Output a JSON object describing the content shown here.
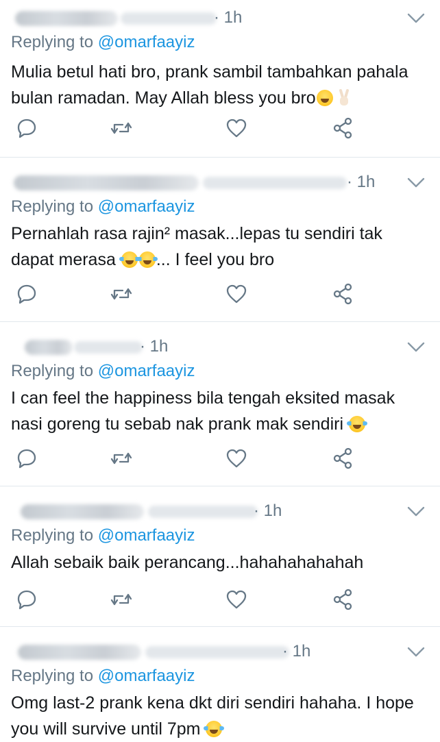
{
  "tweets": [
    {
      "time": "· 1h",
      "replying_label": "Replying to ",
      "mention": "@omarfaayiz",
      "text_lines": [
        "Mulia betul hati bro, prank sambil tambahkan pahala",
        "bulan ramadan. May Allah bless you bro"
      ]
    },
    {
      "time": "· 1h",
      "replying_label": "Replying to ",
      "mention": "@omarfaayiz",
      "text_lines": [
        "Pernahlah rasa rajin² masak...lepas tu sendiri tak",
        "dapat merasa",
        "... I feel you bro"
      ]
    },
    {
      "time": "· 1h",
      "replying_label": "Replying to ",
      "mention": "@omarfaayiz",
      "text_lines": [
        "I can feel the happiness bila tengah eksited masak",
        "nasi goreng tu sebab nak prank mak sendiri"
      ]
    },
    {
      "time": "· 1h",
      "replying_label": "Replying to ",
      "mention": "@omarfaayiz",
      "text_lines": [
        "Allah sebaik baik perancang...hahahahahahah"
      ]
    },
    {
      "time": "· 1h",
      "replying_label": "Replying to ",
      "mention": "@omarfaayiz",
      "text_lines": [
        "Omg last-2 prank kena dkt diri sendiri hahaha. I hope",
        "you will survive until 7pm"
      ]
    }
  ],
  "icons": {
    "reply": "reply-icon",
    "retweet": "retweet-icon",
    "like": "heart-icon",
    "share": "share-icon",
    "more": "chevron-down-icon"
  },
  "colors": {
    "text": "#14171a",
    "secondary": "#657786",
    "mention": "#1b95e0",
    "divider": "#e1e8ed"
  }
}
